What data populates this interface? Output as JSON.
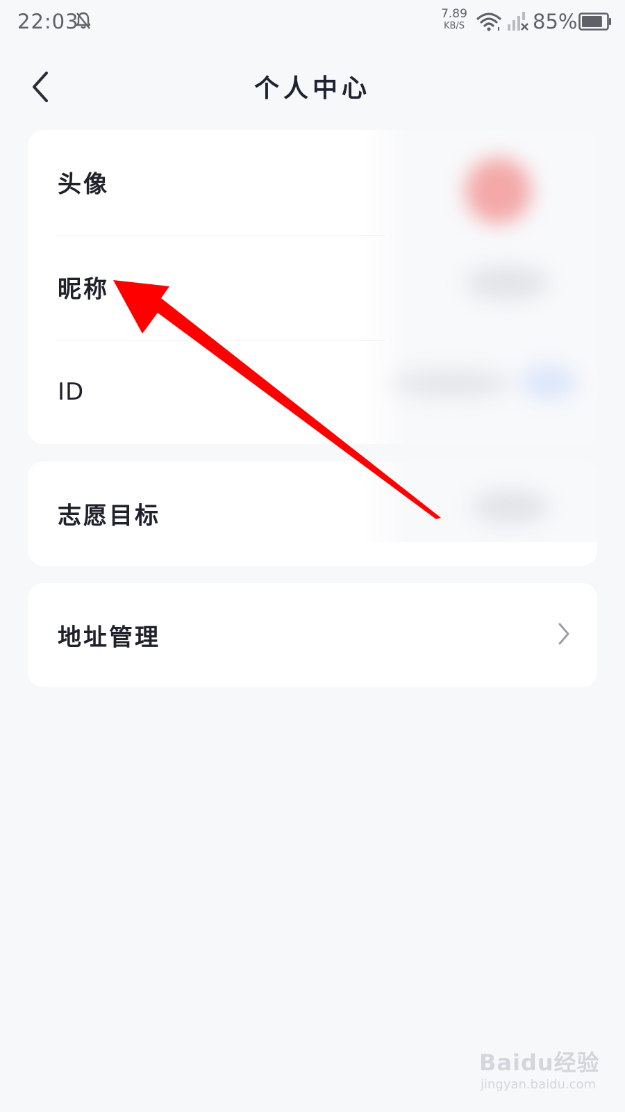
{
  "status_bar": {
    "time": "22:03",
    "net_speed_value": "7.89",
    "net_speed_unit": "KB/S",
    "battery_percent": "85%",
    "battery_level": 0.85
  },
  "nav": {
    "title": "个人中心"
  },
  "profile_rows": [
    {
      "label": "头像"
    },
    {
      "label": "昵称"
    },
    {
      "label": "ID"
    }
  ],
  "goal_row": {
    "label": "志愿目标"
  },
  "address_row": {
    "label": "地址管理"
  },
  "icons": {
    "back": "chevron-left-icon",
    "row_arrow": "chevron-right-icon"
  },
  "colors": {
    "background": "#f7f8fa",
    "card": "#ffffff",
    "annotation_arrow": "#ff0000"
  },
  "watermark": {
    "main": "Baidu经验",
    "sub": "jingyan.baidu.com"
  }
}
